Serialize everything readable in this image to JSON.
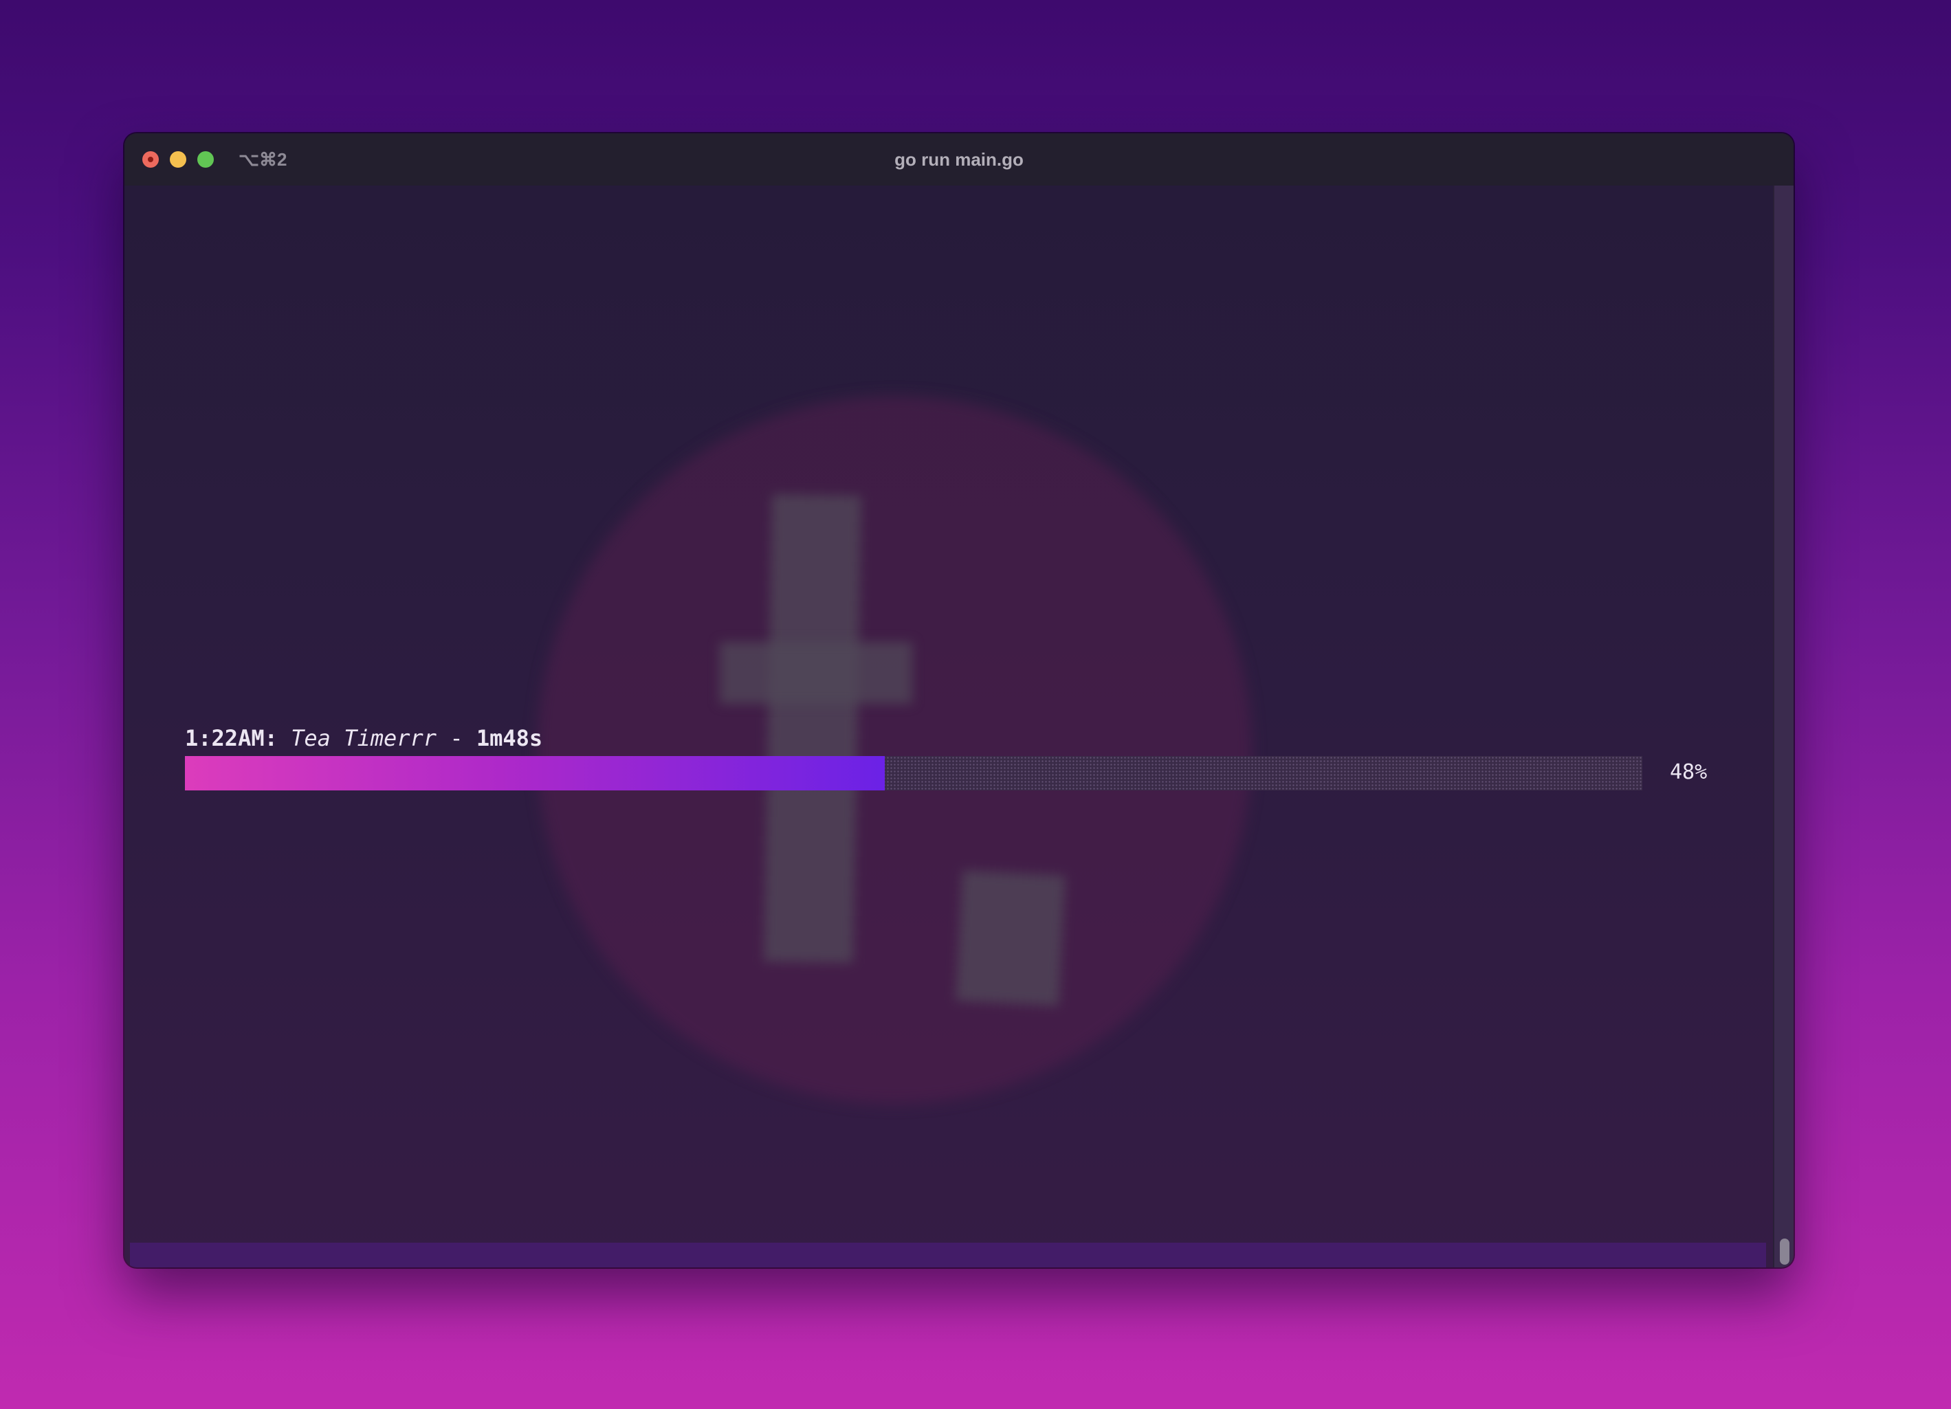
{
  "window": {
    "title": "go run main.go",
    "shortcut": "⌥⌘2"
  },
  "terminal": {
    "time": "1:22AM:",
    "task_name": "Tea Timerrr",
    "separator": "-",
    "remaining": "1m48s",
    "progress_percent": 48,
    "progress_label": "48%"
  },
  "colors": {
    "progress_start": "#dc3cbc",
    "progress_end": "#6b22e6",
    "terminal_bg": "#2b1c3f",
    "status_line": "#431c68"
  },
  "icons": {
    "close": "close-circle",
    "minimize": "minimize-circle",
    "maximize": "maximize-circle",
    "watermark": "logo-watermark"
  }
}
